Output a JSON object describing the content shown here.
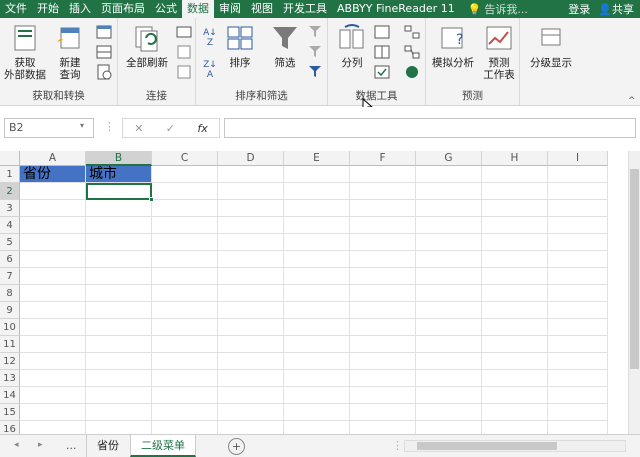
{
  "ribbon_tabs": [
    "文件",
    "开始",
    "插入",
    "页面布局",
    "公式",
    "数据",
    "审阅",
    "视图",
    "开发工具",
    "ABBYY FineReader 11"
  ],
  "tell_me": "告诉我...",
  "signin": "登录",
  "share": "共享",
  "ribbon": {
    "get_external": "获取\n外部数据",
    "new_query": "新建\n查询",
    "refresh_all": "全部刷新",
    "sort": "排序",
    "filter": "筛选",
    "text_to_columns": "分列",
    "what_if": "模拟分析",
    "forecast": "预测\n工作表",
    "outline": "分级显示",
    "groups": {
      "get_transform": "获取和转换",
      "connections": "连接",
      "sort_filter": "排序和筛选",
      "data_tools": "数据工具",
      "forecast": "预测"
    }
  },
  "formula_bar": {
    "name_box": "B2",
    "fx": "fx",
    "formula": ""
  },
  "columns": [
    "A",
    "B",
    "C",
    "D",
    "E",
    "F",
    "G",
    "H",
    "I"
  ],
  "rows": [
    "1",
    "2",
    "3",
    "4",
    "5",
    "6",
    "7",
    "8",
    "9",
    "10",
    "11",
    "12",
    "13",
    "14",
    "15",
    "16"
  ],
  "cells": {
    "A1": "省份",
    "B1": "城市"
  },
  "sheets": [
    "...",
    "省份",
    "二级菜单"
  ],
  "active_sheet": "二级菜单",
  "colors": {
    "brand": "#217346",
    "header_fill": "#4472c4",
    "selection": "#217346"
  }
}
